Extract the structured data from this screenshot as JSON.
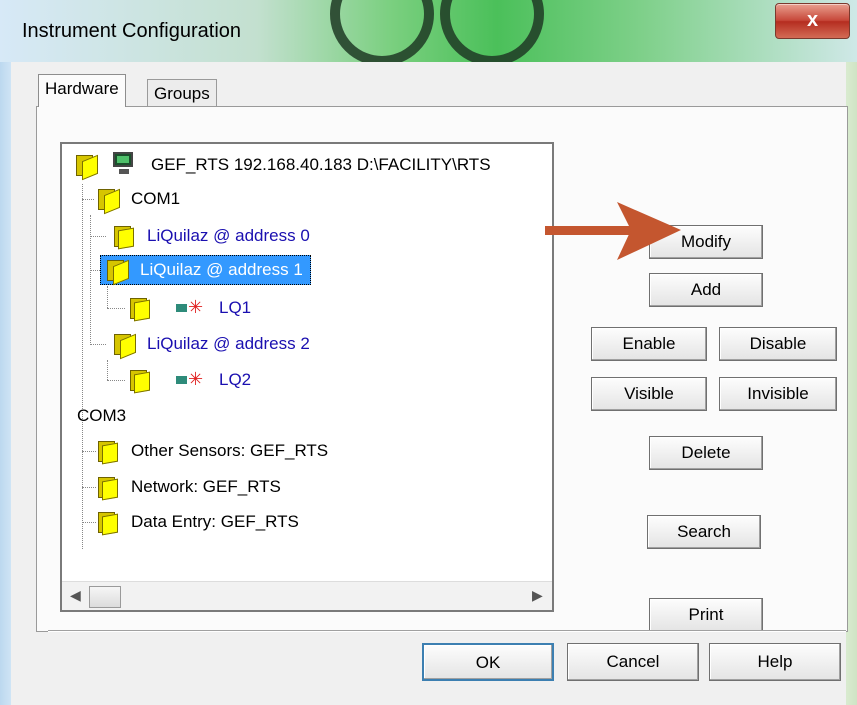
{
  "window": {
    "title": "Instrument Configuration",
    "close_label": "x"
  },
  "tabs": [
    {
      "label": "Hardware",
      "active": true
    },
    {
      "label": "Groups",
      "active": false
    }
  ],
  "tree": {
    "root": {
      "label": "GEF_RTS 192.168.40.183 D:\\FACILITY\\RTS",
      "icon": "computer-icon"
    },
    "com1": {
      "label": "COM1",
      "icon": "folder-open-icon"
    },
    "addr0": {
      "label": "LiQuilaz @ address 0",
      "icon": "folder-icon"
    },
    "addr1": {
      "label": "LiQuilaz @ address 1",
      "icon": "folder-open-icon",
      "selected": true
    },
    "lq1_folder": {
      "icon": "folder-icon"
    },
    "lq1": {
      "label": "LQ1",
      "icon": "sensor-icon"
    },
    "addr2": {
      "label": "LiQuilaz @ address 2",
      "icon": "folder-open-icon"
    },
    "lq2_folder": {
      "icon": "folder-icon"
    },
    "lq2": {
      "label": "LQ2",
      "icon": "sensor-icon"
    },
    "com3": {
      "label": "COM3"
    },
    "other": {
      "label": "Other Sensors: GEF_RTS",
      "icon": "folder-icon"
    },
    "network": {
      "label": "Network: GEF_RTS",
      "icon": "folder-icon"
    },
    "dataentry": {
      "label": "Data Entry: GEF_RTS",
      "icon": "folder-icon"
    }
  },
  "buttons": {
    "modify": "Modify",
    "add": "Add",
    "enable": "Enable",
    "disable": "Disable",
    "visible": "Visible",
    "invisible": "Invisible",
    "delete": "Delete",
    "search": "Search",
    "print": "Print",
    "ok": "OK",
    "cancel": "Cancel",
    "help": "Help"
  },
  "colors": {
    "selection": "#3399ff",
    "device_text": "#1a0fb0",
    "annotation_arrow": "#c4562f"
  }
}
